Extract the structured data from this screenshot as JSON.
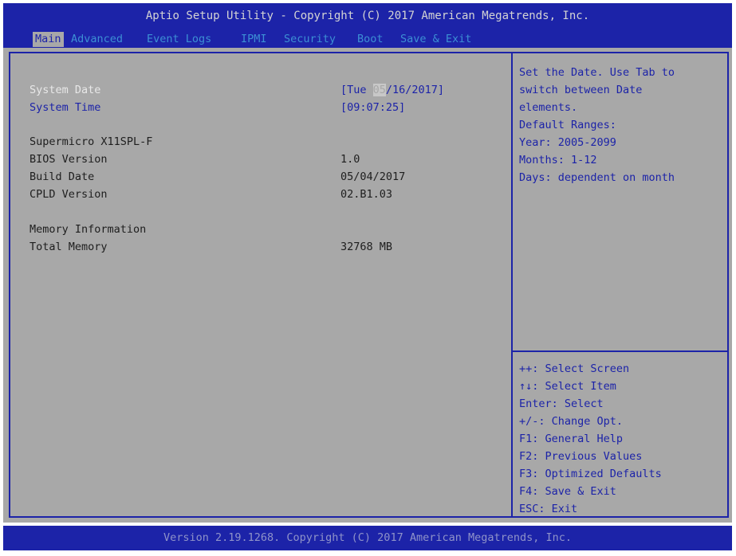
{
  "header": {
    "title": "Aptio Setup Utility - Copyright (C) 2017 American Megatrends, Inc.",
    "tabs": [
      {
        "label": "Main"
      },
      {
        "label": "Advanced"
      },
      {
        "label": "Event Logs"
      },
      {
        "label": "IPMI"
      },
      {
        "label": "Security"
      },
      {
        "label": "Boot"
      },
      {
        "label": "Save & Exit"
      }
    ]
  },
  "main": {
    "system_date": {
      "label": "System Date",
      "value_prefix": "[Tue ",
      "value_cursor": "05",
      "value_suffix": "/16/2017]"
    },
    "system_time": {
      "label": "System Time",
      "value": "[09:07:25]"
    },
    "board_name": "Supermicro X11SPL-F",
    "bios_version": {
      "label": "BIOS Version",
      "value": "1.0"
    },
    "build_date": {
      "label": "Build Date",
      "value": "05/04/2017"
    },
    "cpld_version": {
      "label": "CPLD Version",
      "value": "02.B1.03"
    },
    "memory_header": "Memory Information",
    "total_memory": {
      "label": "Total Memory",
      "value": "32768 MB"
    }
  },
  "help": {
    "lines": [
      "Set the Date. Use Tab to",
      "switch between Date",
      "elements.",
      "Default Ranges:",
      "Year: 2005-2099",
      "Months: 1-12",
      "Days: dependent on month"
    ],
    "keys": [
      "++: Select Screen",
      "↑↓: Select Item",
      "Enter: Select",
      "+/-: Change Opt.",
      "F1: General Help",
      "F2: Previous Values",
      "F3: Optimized Defaults",
      "F4: Save & Exit",
      "ESC: Exit"
    ]
  },
  "footer": {
    "text": "Version 2.19.1268. Copyright (C) 2017 American Megatrends, Inc."
  },
  "colors": {
    "bios_blue": "#1c23a8",
    "panel_gray": "#a8a8a8",
    "highlight_white": "#e8e8e8",
    "tab_cyan": "#3c8fd4"
  }
}
